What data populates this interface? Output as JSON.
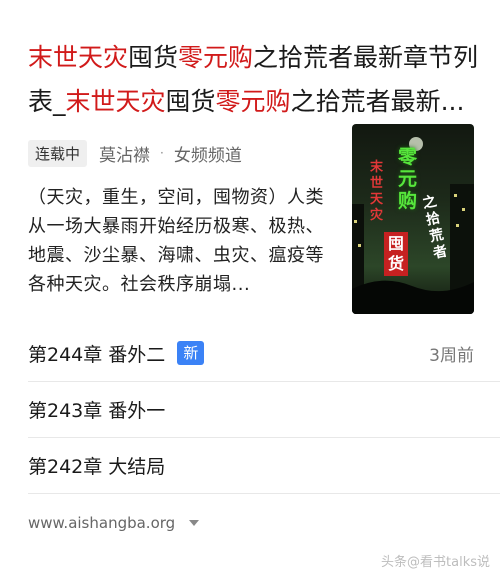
{
  "result": {
    "title": {
      "p1": "末世天灾",
      "p2": "囤货",
      "p3": "零元购",
      "p4": "之拾荒者最新章节列表_",
      "p5": "末世天灾",
      "p6": "囤货",
      "p7": "零元购",
      "p8": "之拾荒者最新..."
    },
    "status_badge": "连载中",
    "author": "莫沾襟",
    "separator": "·",
    "category": "女频频道",
    "description": "（天灾，重生，空间，囤物资）人类从一场大暴雨开始经历极寒、极热、地震、沙尘暴、海啸、虫灾、瘟疫等各种天灾。社会秩序崩塌...",
    "cover": {
      "main": "零元购",
      "left": "末世天灾",
      "hoard": "囤货",
      "right": "之拾荒者"
    },
    "chapters": [
      {
        "name": "第244章 番外二",
        "badge": "新",
        "time": "3周前"
      },
      {
        "name": "第243章 番外一"
      },
      {
        "name": "第242章 大结局"
      }
    ],
    "site": "www.aishangba.org"
  },
  "watermark": "头条@看书talks说"
}
